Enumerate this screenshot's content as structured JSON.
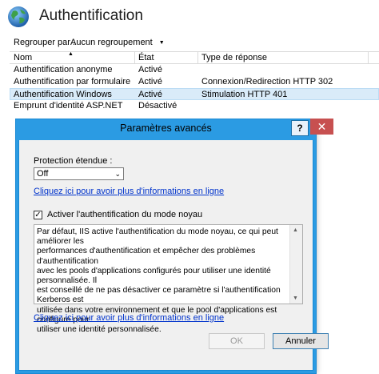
{
  "header": {
    "title": "Authentification"
  },
  "toolbar": {
    "group_label": "Regrouper par :",
    "group_value": "Aucun regroupement"
  },
  "list": {
    "columns": [
      "Nom",
      "État",
      "Type de réponse"
    ],
    "rows": [
      [
        "Authentification anonyme",
        "Activé",
        ""
      ],
      [
        "Authentification par formulaire",
        "Activé",
        "Connexion/Redirection HTTP 302"
      ],
      [
        "Authentification Windows",
        "Activé",
        "Stimulation HTTP 401"
      ],
      [
        "Emprunt d'identité ASP.NET",
        "Désactivé",
        ""
      ]
    ]
  },
  "dialog": {
    "title": "Paramètres avancés",
    "help": "?",
    "close": "✕",
    "protection_label": "Protection étendue :",
    "protection_value": "Off",
    "more_info_link": "Cliquez ici pour avoir plus d'informations en ligne",
    "kernel_mode_label": "Activer l'authentification du mode noyau",
    "kernel_mode_checked": true,
    "description": [
      "Par défaut, IIS active l'authentification du mode noyau, ce qui peut améliorer les",
      "performances d'authentification et empêcher des problèmes d'authentification",
      "avec les pools d'applications configurés pour utiliser une identité personnalisée. Il",
      "est conseillé de ne pas désactiver ce paramètre si l'authentification Kerberos est",
      "utilisée dans votre environnement et que le pool d'applications est configuré pour",
      "utiliser une identité personnalisée."
    ],
    "more_info_link2": "Cliquez ici pour avoir plus d'informations en ligne",
    "ok_label": "OK",
    "cancel_label": "Annuler"
  },
  "colors": {
    "titlebar": "#2b9be3",
    "selection": "#d9ebf9",
    "link": "#0033cc",
    "close_button": "#c75050"
  }
}
